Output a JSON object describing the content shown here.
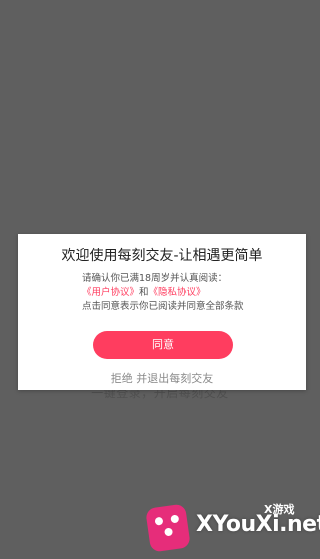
{
  "background_text": "一键登录，开启每刻交友",
  "dialog": {
    "title": "欢迎使用每刻交友-让相遇更简单",
    "line1": "请确认你已满18周岁并认真阅读：",
    "user_agreement_link": "《用户协议》",
    "and_text": "和",
    "privacy_link": "《隐私协议》",
    "line3": "点击同意表示你已阅读并同意全部条款",
    "agree_button": "同意",
    "reject_link": "拒绝 并退出每刻交友"
  },
  "watermark": {
    "brand": "XYouXi.net",
    "tag": "X游戏"
  },
  "colors": {
    "accent": "#ff3d5f",
    "overlay": "#5f5f5f",
    "logo": "#e62d7a"
  }
}
